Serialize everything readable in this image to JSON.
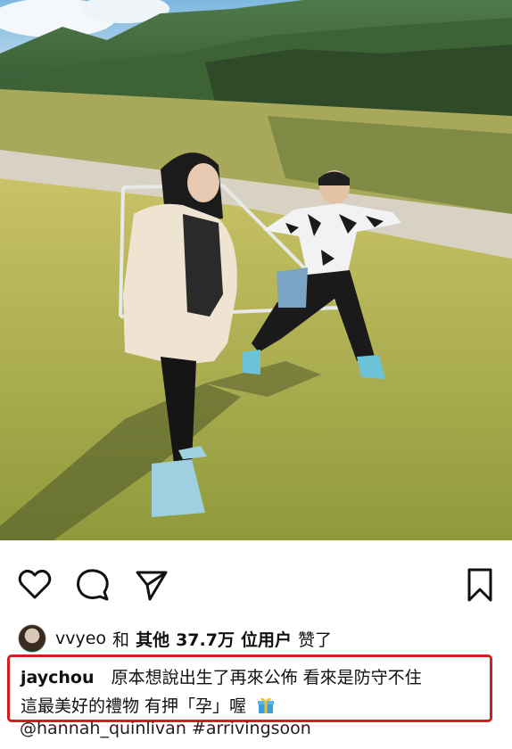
{
  "post": {
    "image_description_alt": "",
    "likes": {
      "avatar_user": "vvyeo",
      "and_text": "和",
      "others_text": "其他",
      "count": "37.7万",
      "users_text": "位用户",
      "suffix": "赞了"
    },
    "caption": {
      "author": "jaychou",
      "line1": "原本想說出生了再來公佈 看來是防守不住",
      "line2": "這最美好的禮物 有押「孕」喔"
    },
    "tags": "@hannah_quinlivan #arrivingsoon"
  },
  "icons": {
    "like": "heart-icon",
    "comment": "comment-icon",
    "share": "send-icon",
    "save": "bookmark-icon",
    "gift": "gift-emoji-icon"
  },
  "colors": {
    "highlight_border": "#d51f1f",
    "text": "#111111",
    "gift_ribbon": "#f0c020",
    "gift_box": "#3aa0e0"
  }
}
